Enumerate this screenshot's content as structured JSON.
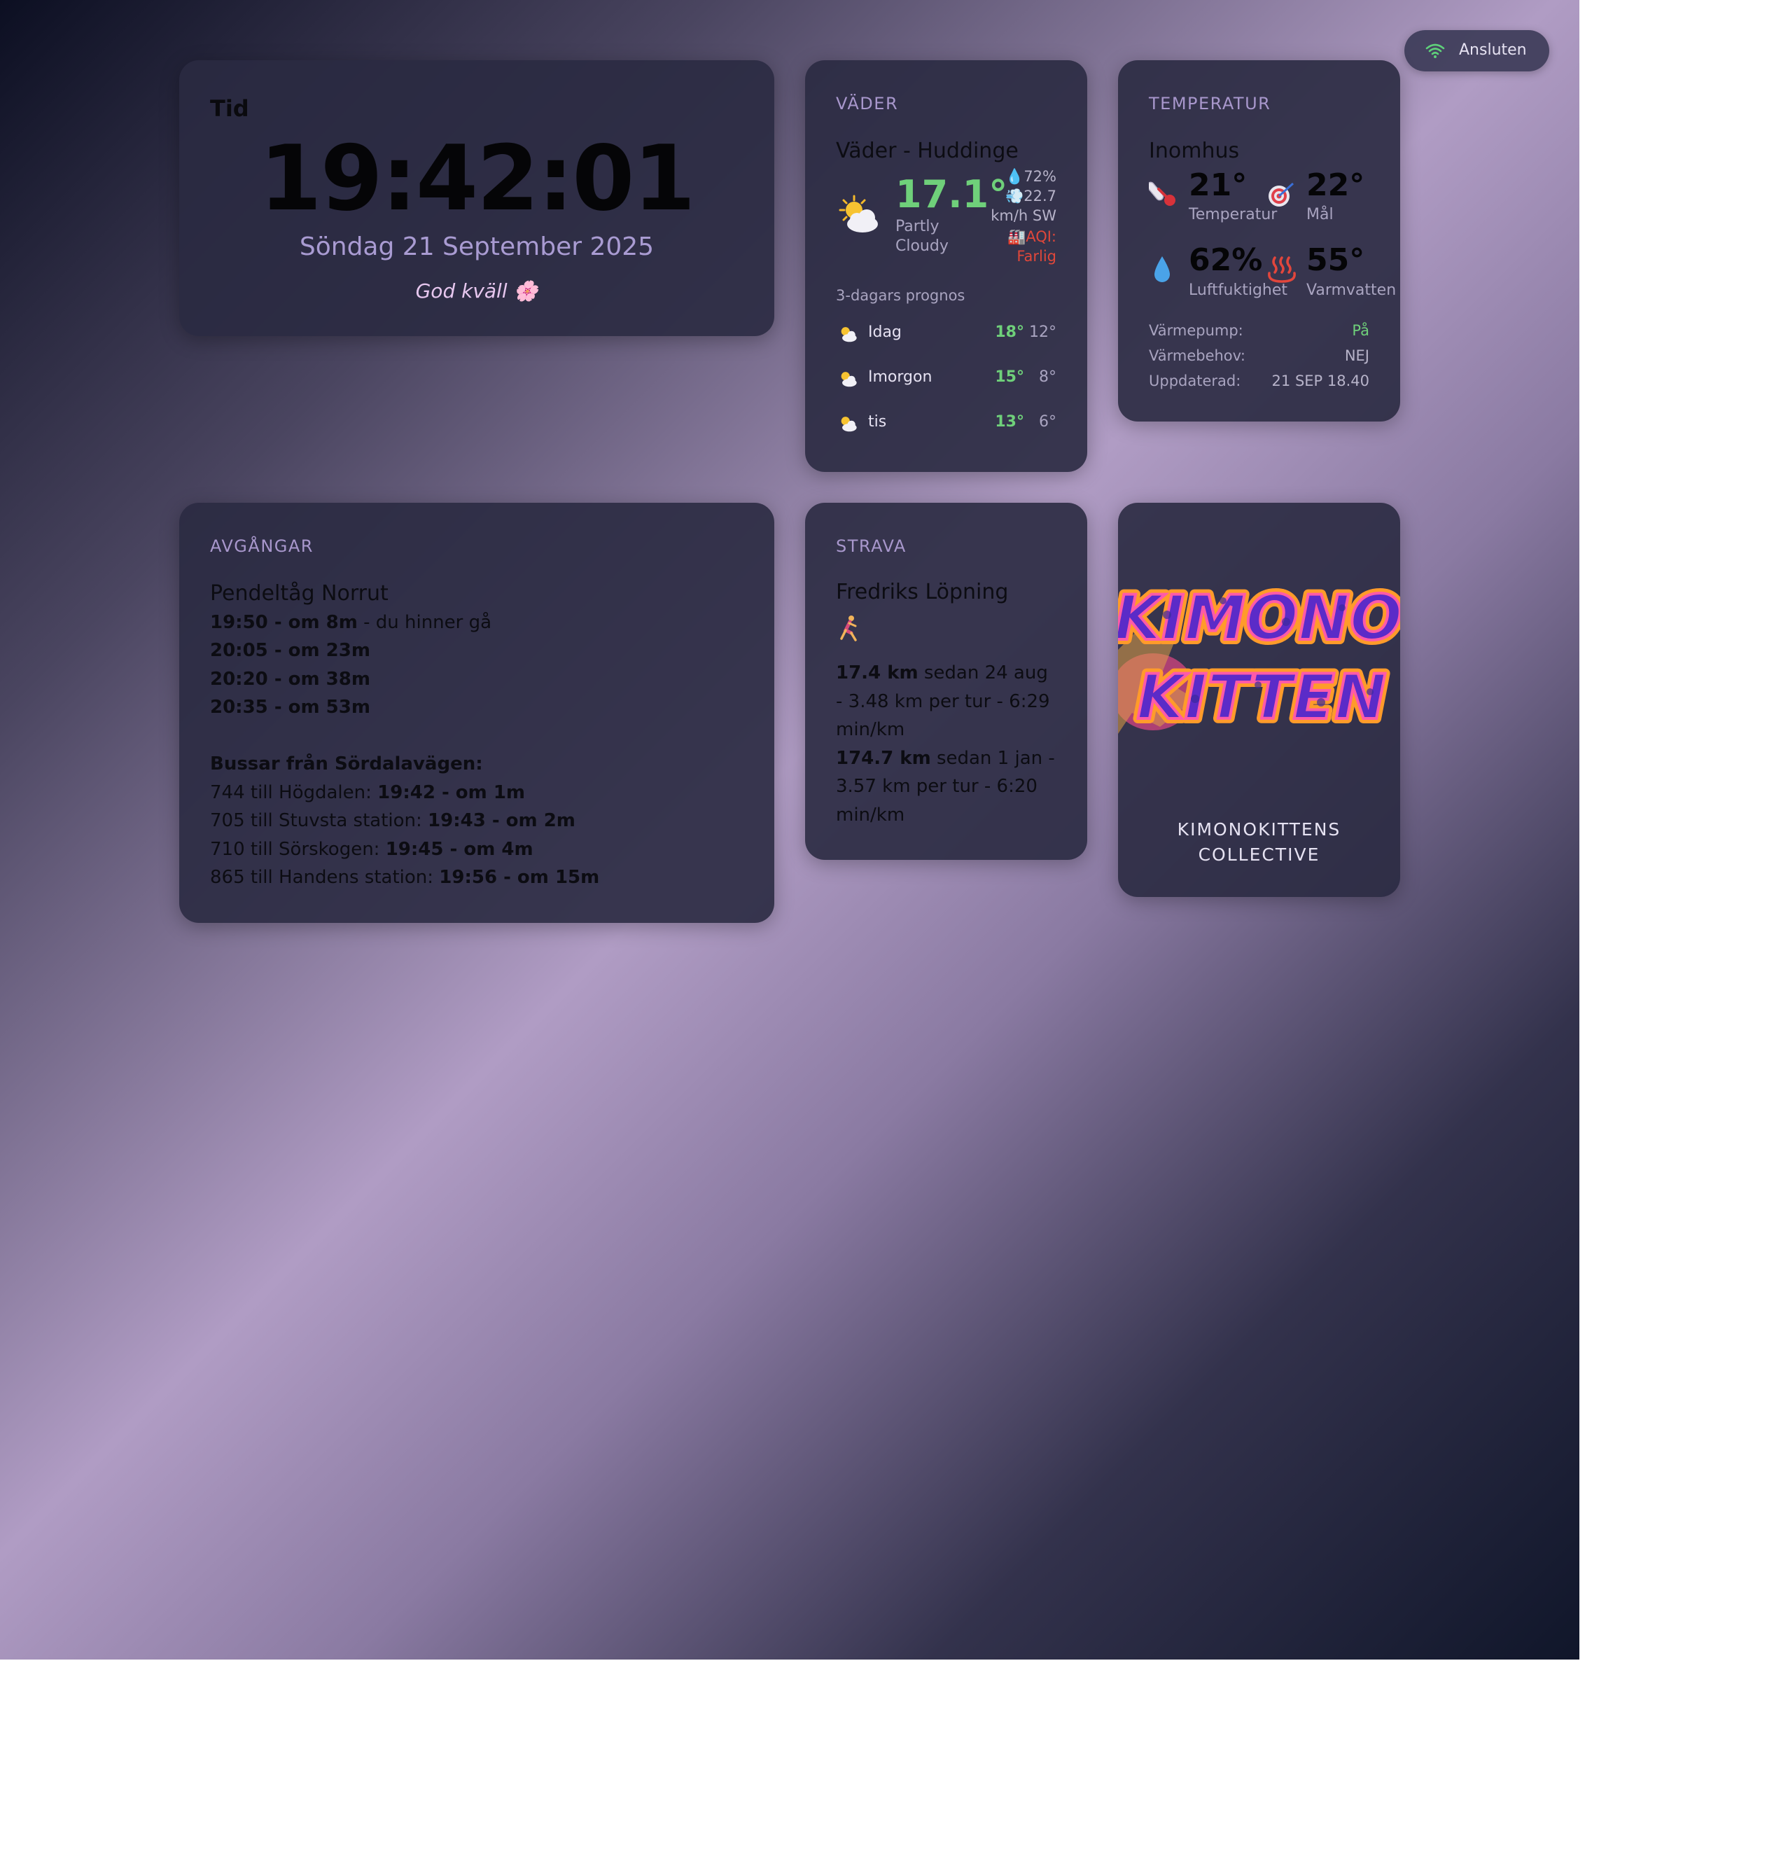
{
  "status": {
    "label": "Ansluten",
    "color": "#5fd07a"
  },
  "clock": {
    "title": "Tid",
    "time": "19:42:01",
    "date": "Söndag 21 September 2025",
    "greeting": "God kväll 🌸"
  },
  "weather": {
    "heading": "VÄDER",
    "title": "Väder - Huddinge",
    "icon": "sun-behind-cloud-icon",
    "temperature": "17.1°",
    "condition": "Partly Cloudy",
    "humidity": "72%",
    "wind": "22.7 km/h SW",
    "aqi": "AQI: Farlig",
    "forecast_title": "3-dagars prognos",
    "forecast": [
      {
        "day": "Idag",
        "high": "18°",
        "low": "12°"
      },
      {
        "day": "Imorgon",
        "high": "15°",
        "low": "8°"
      },
      {
        "day": "tis",
        "high": "13°",
        "low": "6°"
      }
    ]
  },
  "indoor": {
    "heading": "TEMPERATUR",
    "subtitle": "Inomhus",
    "temperature": {
      "value": "21°",
      "label": "Temperatur"
    },
    "target": {
      "value": "22°",
      "label": "Mål"
    },
    "humidity": {
      "value": "62%",
      "label": "Luftfuktighet"
    },
    "hot_water": {
      "value": "55°",
      "label": "Varmvatten"
    },
    "rows": [
      {
        "label": "Värmepump:",
        "value": "På"
      },
      {
        "label": "Värmebehov:",
        "value": "NEJ"
      },
      {
        "label": "Uppdaterad:",
        "value": "21 SEP 18.40"
      }
    ]
  },
  "departures": {
    "heading": "AVGÅNGAR",
    "train_title": "Pendeltåg Norrut",
    "trains": [
      {
        "time": "19:50 - om 8m",
        "note": " - du hinner gå"
      },
      {
        "time": "20:05 - om 23m",
        "note": ""
      },
      {
        "time": "20:20 - om 38m",
        "note": ""
      },
      {
        "time": "20:35 - om 53m",
        "note": ""
      }
    ],
    "bus_title": "Bussar från Sördalavägen:",
    "buses": [
      {
        "route": "744 till Högdalen: ",
        "time": "19:42 - om 1m"
      },
      {
        "route": "705 till Stuvsta station: ",
        "time": "19:43 - om 2m"
      },
      {
        "route": "710 till Sörskogen: ",
        "time": "19:45 - om 4m"
      },
      {
        "route": "865 till Handens station: ",
        "time": "19:56 - om 15m"
      }
    ]
  },
  "strava": {
    "heading": "STRAVA",
    "title": "Fredriks Löpning",
    "stats": [
      {
        "distance": "17.4 km",
        "text": " sedan 24 aug - 3.48 km per tur - 6:29 min/km"
      },
      {
        "distance": "174.7 km",
        "text": " sedan 1 jan - 3.57 km per tur - 6:20 min/km"
      }
    ]
  },
  "kimono": {
    "logo_text": "KIMONO KITTEN",
    "caption": "KIMONOKITTENS COLLECTIVE"
  }
}
